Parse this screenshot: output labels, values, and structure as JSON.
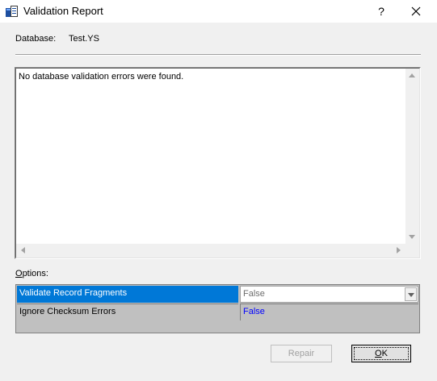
{
  "window": {
    "title": "Validation Report",
    "help_glyph": "?",
    "close_glyph": "×",
    "app_icon": "database-app-icon"
  },
  "database": {
    "label": "Database:",
    "value": "Test.YS"
  },
  "report": {
    "message": "No database validation errors were found."
  },
  "options": {
    "label": "Options:",
    "rows": [
      {
        "name": "Validate Record Fragments",
        "value": "False",
        "selected": true
      },
      {
        "name": "Ignore Checksum Errors",
        "value": "False",
        "selected": false
      }
    ]
  },
  "buttons": {
    "repair_label": "Repair",
    "repair_enabled": false,
    "ok_label": "OK"
  },
  "colors": {
    "selection": "#0078d7",
    "value_link": "#0000ff",
    "grid_bg": "#c0c0c0",
    "dialog_bg": "#f0f0f0"
  }
}
